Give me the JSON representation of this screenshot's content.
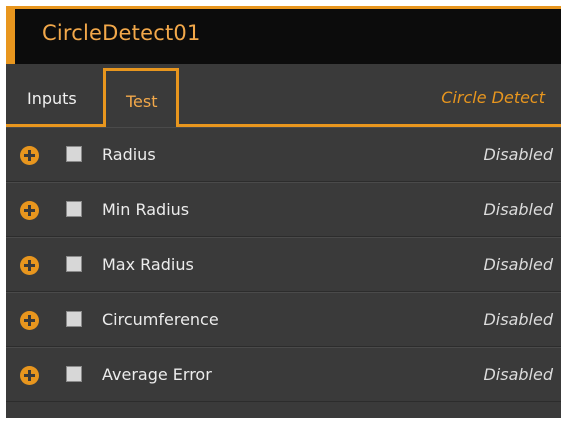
{
  "window": {
    "title": "CircleDetect01"
  },
  "tabs": [
    {
      "label": "Inputs",
      "active": false
    },
    {
      "label": "Test",
      "active": true
    }
  ],
  "tool_type": "Circle Detect",
  "tests": [
    {
      "label": "Radius",
      "checked": false,
      "status": "Disabled"
    },
    {
      "label": "Min Radius",
      "checked": false,
      "status": "Disabled"
    },
    {
      "label": "Max Radius",
      "checked": false,
      "status": "Disabled"
    },
    {
      "label": "Circumference",
      "checked": false,
      "status": "Disabled"
    },
    {
      "label": "Average Error",
      "checked": false,
      "status": "Disabled"
    }
  ],
  "colors": {
    "accent": "#e8961e",
    "panel_bg": "#3a3a3a",
    "title_bg": "#0c0c0c",
    "text": "#ececec"
  },
  "icons": {
    "expand": "plus-circle-icon",
    "checkbox": "checkbox-unchecked"
  }
}
